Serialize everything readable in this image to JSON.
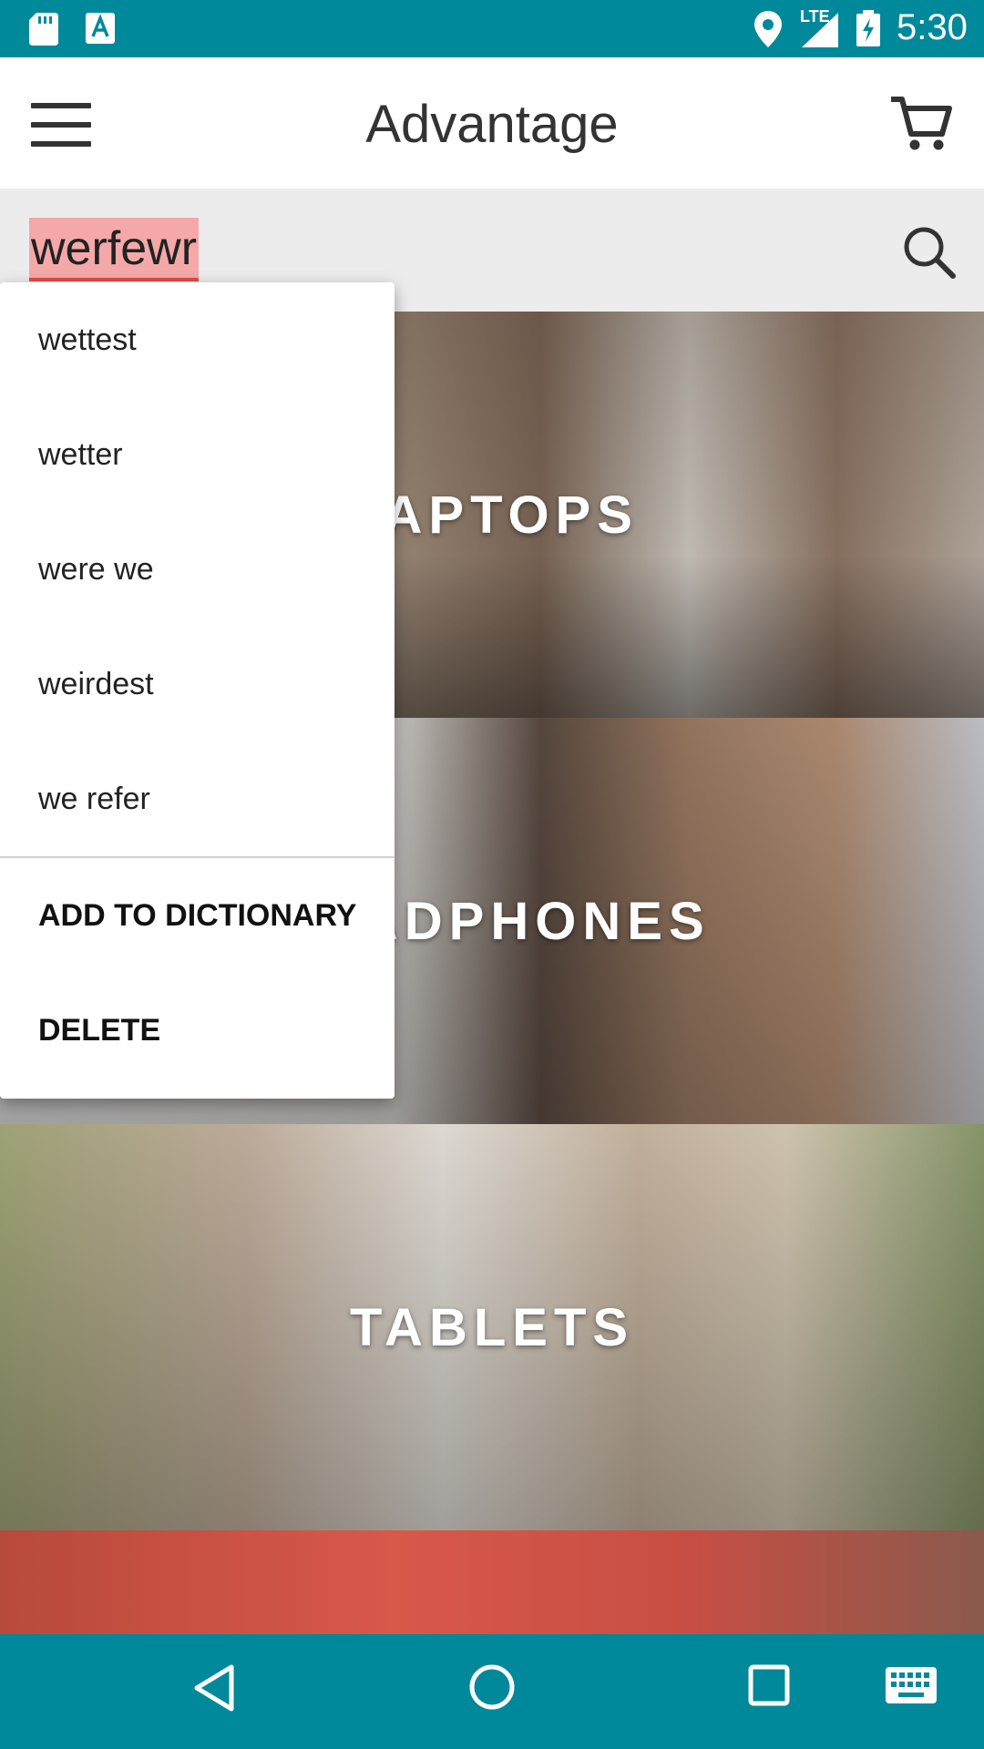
{
  "status_bar": {
    "time": "5:30",
    "network_label": "LTE",
    "icons": [
      "sd-card-icon",
      "notification-a-icon",
      "location-icon",
      "signal-icon",
      "battery-charging-icon"
    ]
  },
  "app_bar": {
    "title": "Advantage",
    "icons": [
      "menu-icon",
      "cart-icon"
    ]
  },
  "search": {
    "value": "werfewr",
    "icon": "search-icon"
  },
  "categories": [
    {
      "label": "LAPTOPS",
      "visible_label": "APTOPS"
    },
    {
      "label": "HEADPHONES",
      "visible_label": "ADPHONES"
    },
    {
      "label": "TABLETS",
      "visible_label": "TABLETS"
    }
  ],
  "suggestions": {
    "words": [
      "wettest",
      "wetter",
      "were we",
      "weirdest",
      "we refer"
    ],
    "actions": [
      "ADD TO DICTIONARY",
      "DELETE"
    ]
  },
  "nav_bar": {
    "icons": [
      "back-icon",
      "home-icon",
      "recent-apps-icon",
      "keyboard-icon"
    ]
  },
  "colors": {
    "primary": "#00899a",
    "misspelling_highlight": "#f5a8a8",
    "misspelling_underline": "#e24c4c"
  }
}
